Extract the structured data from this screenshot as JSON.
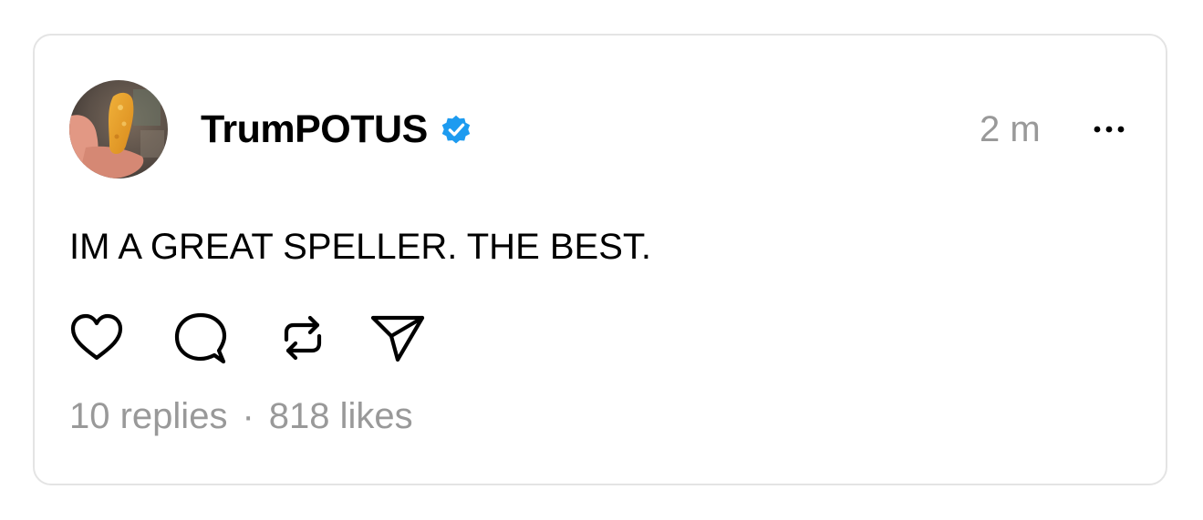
{
  "post": {
    "author": {
      "username": "TrumPOTUS",
      "verified": true,
      "verified_color": "#1d9bf0",
      "avatar_icon": "avatar-photo"
    },
    "timestamp": "2 m",
    "more_icon": "more-icon",
    "text": "IM A GREAT SPELLER. THE BEST.",
    "actions": [
      {
        "name": "like-button",
        "icon": "heart-icon"
      },
      {
        "name": "reply-button",
        "icon": "comment-icon"
      },
      {
        "name": "repost-button",
        "icon": "repost-icon"
      },
      {
        "name": "share-button",
        "icon": "send-icon"
      }
    ],
    "stats": {
      "replies": "10 replies",
      "separator": "·",
      "likes": "818 likes"
    }
  }
}
